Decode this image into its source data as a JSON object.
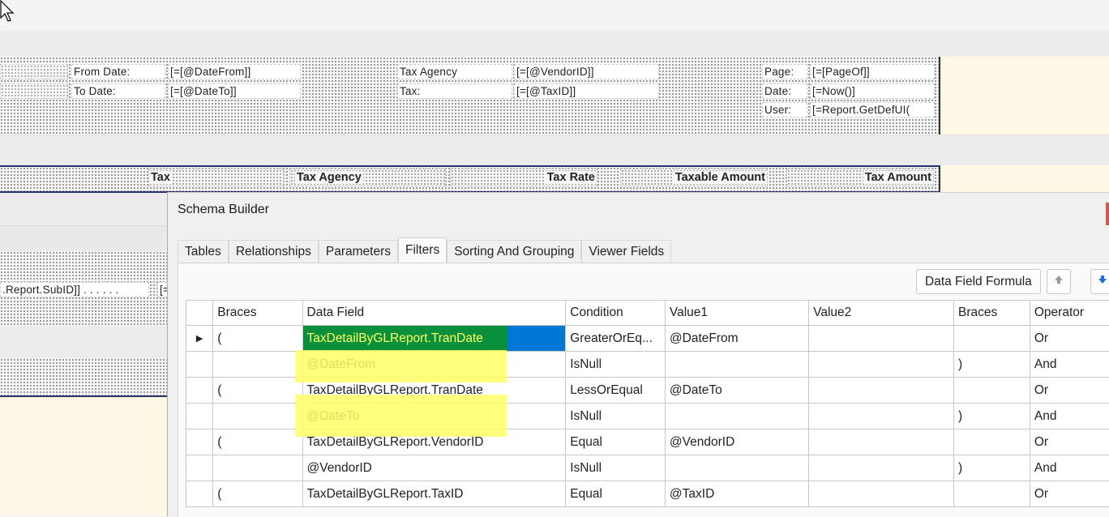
{
  "report": {
    "header": {
      "from_date_label": "From Date:",
      "from_date_value": "[=[@DateFrom]]",
      "to_date_label": "To Date:",
      "to_date_value": "[=[@DateTo]]",
      "tax_agency_label": "Tax Agency",
      "tax_agency_value": "[=[@VendorID]]",
      "tax_label": "Tax:",
      "tax_value": "[=[@TaxID]]",
      "page_label": "Page:",
      "page_value": "[=[PageOf]]",
      "date_label": "Date:",
      "date_value": "[=Now()]",
      "user_label": "User:",
      "user_value": "[=Report.GetDefUI("
    },
    "columns": {
      "tax": "Tax",
      "tax_agency": "Tax Agency",
      "tax_rate": "Tax Rate",
      "taxable_amount": "Taxable Amount",
      "tax_amount": "Tax Amount"
    },
    "detail_field": ".Report.SubID]] . . . . . .",
    "detail_field_2": "[="
  },
  "schema_builder": {
    "title": "Schema Builder",
    "tabs": [
      "Tables",
      "Relationships",
      "Parameters",
      "Filters",
      "Sorting And Grouping",
      "Viewer Fields"
    ],
    "active_tab": "Filters",
    "data_field_formula_label": "Data Field Formula",
    "up_icon": "arrow-up-icon",
    "down_icon": "arrow-down-icon",
    "grid_headers": [
      "Braces",
      "Data Field",
      "Condition",
      "Value1",
      "Value2",
      "Braces",
      "Operator"
    ],
    "rows": [
      {
        "braces": "(",
        "field": "TaxDetailByGLReport.TranDate",
        "condition": "GreaterOrEq...",
        "value1": "@DateFrom",
        "value2": "",
        "braces2": "",
        "operator": "Or"
      },
      {
        "braces": "",
        "field": "@DateFrom",
        "condition": "IsNull",
        "value1": "",
        "value2": "",
        "braces2": ")",
        "operator": "And"
      },
      {
        "braces": "(",
        "field": "TaxDetailByGLReport.TranDate",
        "condition": "LessOrEqual",
        "value1": "@DateTo",
        "value2": "",
        "braces2": "",
        "operator": "Or"
      },
      {
        "braces": "",
        "field": "@DateTo",
        "condition": "IsNull",
        "value1": "",
        "value2": "",
        "braces2": ")",
        "operator": "And"
      },
      {
        "braces": "(",
        "field": "TaxDetailByGLReport.VendorID",
        "condition": "Equal",
        "value1": "@VendorID",
        "value2": "",
        "braces2": "",
        "operator": "Or"
      },
      {
        "braces": "",
        "field": "@VendorID",
        "condition": "IsNull",
        "value1": "",
        "value2": "",
        "braces2": ")",
        "operator": "And"
      },
      {
        "braces": "(",
        "field": "TaxDetailByGLReport.TaxID",
        "condition": "Equal",
        "value1": "@TaxID",
        "value2": "",
        "braces2": "",
        "operator": "Or"
      }
    ],
    "colors": {
      "selected_cell": "#0a8f3a",
      "row_selection": "#0078d7",
      "highlight": "#ffff66"
    }
  }
}
